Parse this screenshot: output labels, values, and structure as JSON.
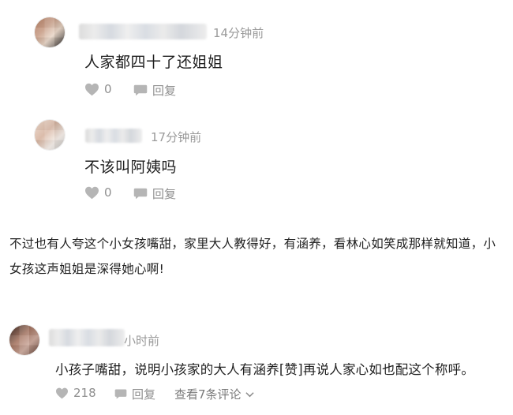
{
  "comments": [
    {
      "time": "14分钟前",
      "text": "人家都四十了还姐姐",
      "likes": "0",
      "reply_label": "回复",
      "avatar_icon": "user-avatar-icon"
    },
    {
      "time": "17分钟前",
      "text": "不该叫阿姨吗",
      "likes": "0",
      "reply_label": "回复",
      "avatar_icon": "user-avatar-icon"
    }
  ],
  "article": {
    "line1": "不过也有人夸这个小女孩嘴甜，家里大人教得好，有涵养，看林心如笑成那样就知道，小",
    "line2": "女孩这声姐姐是深得她心啊!"
  },
  "comment3": {
    "time": "小时前",
    "text": "小孩子嘴甜，说明小孩家的大人有涵养[赞]再说人家心如也配这个称呼。",
    "likes": "218",
    "reply_label": "回复",
    "view_replies": "查看7条评论"
  },
  "colors": {
    "text_primary": "#1f1f1f",
    "text_secondary": "#9a9a9a",
    "icon": "#a9a9a9"
  }
}
